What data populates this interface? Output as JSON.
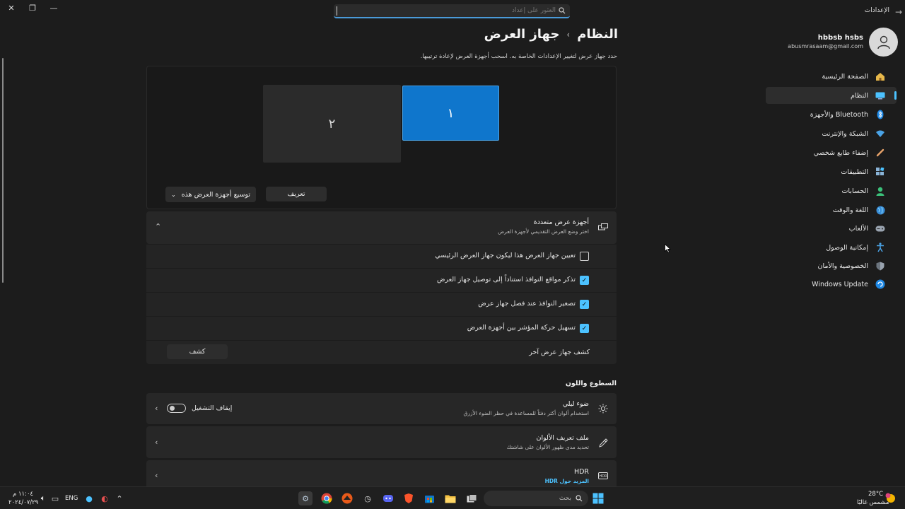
{
  "window": {
    "app_title": "الإعدادات",
    "search_placeholder": "العثور على إعداد"
  },
  "account": {
    "name": "hbbsb hsbs",
    "email": "abusmrasaam@gmail.com"
  },
  "sidebar": {
    "items": [
      {
        "label": "الصفحة الرئيسية",
        "icon": "home-icon"
      },
      {
        "label": "النظام",
        "icon": "system-icon",
        "selected": true
      },
      {
        "label": "Bluetooth والأجهزة",
        "icon": "bluetooth-icon"
      },
      {
        "label": "الشبكة والإنترنت",
        "icon": "wifi-icon"
      },
      {
        "label": "إضفاء طابع شخصي",
        "icon": "brush-icon"
      },
      {
        "label": "التطبيقات",
        "icon": "apps-icon"
      },
      {
        "label": "الحسابات",
        "icon": "person-icon"
      },
      {
        "label": "اللغة والوقت",
        "icon": "globe-icon"
      },
      {
        "label": "الألعاب",
        "icon": "gamepad-icon"
      },
      {
        "label": "إمكانية الوصول",
        "icon": "accessibility-icon"
      },
      {
        "label": "الخصوصية والأمان",
        "icon": "shield-icon"
      },
      {
        "label": "Windows Update",
        "icon": "update-icon"
      }
    ]
  },
  "header": {
    "crumb_parent": "النظام",
    "crumb_current": "جهاز العرض",
    "description": "حدد جهاز عرض لتغيير الإعدادات الخاصة به. اسحب أجهزة العرض لإعادة ترتيبها."
  },
  "arrangement": {
    "monitor_1": "١",
    "monitor_2": "٢",
    "identify_label": "تعريف",
    "mode_label": "توسيع أجهزة العرض هذه"
  },
  "multiple_displays": {
    "title": "أجهزة عرض متعددة",
    "subtitle": "اختر وضع العرض التقديمي لأجهزة العرض",
    "options": [
      {
        "label": "تعيين جهاز العرض هذا ليكون جهاز العرض الرئيسي",
        "checked": false
      },
      {
        "label": "تذكر مواقع النوافذ استناداً إلى توصيل جهاز العرض",
        "checked": true
      },
      {
        "label": "تصغير النوافذ عند فصل جهاز عرض",
        "checked": true
      },
      {
        "label": "تسهيل حركة المؤشر بين أجهزة العرض",
        "checked": true
      }
    ],
    "detect_label": "كشف جهاز عرض آخر",
    "detect_button": "كشف"
  },
  "brightness": {
    "section_title": "السطوع واللون",
    "night_light": {
      "title": "ضوء ليلي",
      "subtitle": "استخدام ألوان أكثر دفئاً للمساعدة في حظر الضوء الأزرق",
      "state": "إيقاف التشغيل",
      "on": false
    },
    "color_profile": {
      "title": "ملف تعريف الألوان",
      "subtitle": "تحديد مدى ظهور الألوان على شاشتك"
    },
    "hdr": {
      "title": "HDR",
      "link": "المزيد حول HDR"
    }
  },
  "taskbar": {
    "search_label": "بحث",
    "weather_temp": "28°C",
    "weather_desc": "مشمس غالبًا",
    "language": "ENG",
    "time": "١١:٠٤ م",
    "date": "٢٠٢٤/٠٧/٢٩"
  },
  "colors": {
    "accent": "#4cc2ff",
    "monitor_selected": "#0f76cc",
    "background": "#1c1c1c"
  }
}
